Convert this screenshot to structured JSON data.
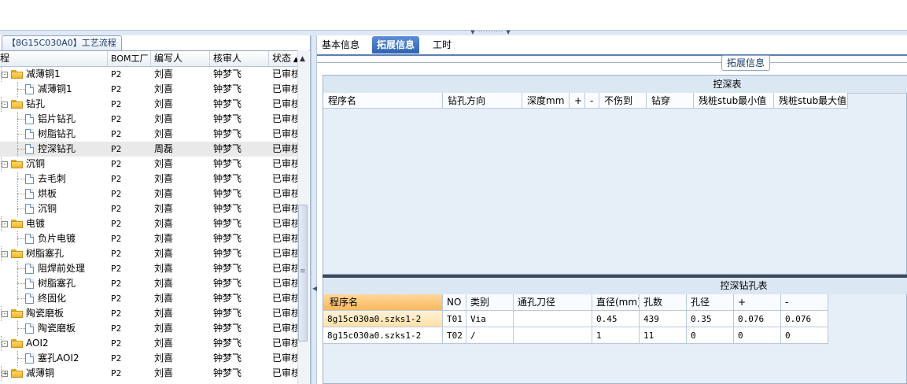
{
  "splitter_grip": "▼ ·········· ▼",
  "left_panel": {
    "title": "【8G15C030A0】工艺流程",
    "columns": [
      "程",
      "BOM工厂",
      "编写人",
      "核审人",
      "状态"
    ],
    "sort_arrow": "▲",
    "rows": [
      {
        "indent": 1,
        "type": "folder",
        "expander": "-",
        "name": "减薄铜1",
        "bom": "P2",
        "author": "刘喜",
        "reviewer": "钟梦飞",
        "status": "已审核"
      },
      {
        "indent": 2,
        "type": "file",
        "expander": "",
        "name": "减薄铜1",
        "bom": "P2",
        "author": "刘喜",
        "reviewer": "钟梦飞",
        "status": "已审核"
      },
      {
        "indent": 1,
        "type": "folder",
        "expander": "-",
        "name": "钻孔",
        "bom": "P2",
        "author": "刘喜",
        "reviewer": "钟梦飞",
        "status": "已审核"
      },
      {
        "indent": 2,
        "type": "file",
        "expander": "",
        "name": "铝片钻孔",
        "bom": "P2",
        "author": "刘喜",
        "reviewer": "钟梦飞",
        "status": "已审核"
      },
      {
        "indent": 2,
        "type": "file",
        "expander": "",
        "name": "树脂钻孔",
        "bom": "P2",
        "author": "刘喜",
        "reviewer": "钟梦飞",
        "status": "已审核"
      },
      {
        "indent": 2,
        "type": "file",
        "expander": "",
        "name": "控深钻孔",
        "bom": "P2",
        "author": "周磊",
        "reviewer": "钟梦飞",
        "status": "已审核",
        "selected": true
      },
      {
        "indent": 1,
        "type": "folder",
        "expander": "-",
        "name": "沉铜",
        "bom": "P2",
        "author": "刘喜",
        "reviewer": "钟梦飞",
        "status": "已审核"
      },
      {
        "indent": 2,
        "type": "file",
        "expander": "",
        "name": "去毛刺",
        "bom": "P2",
        "author": "刘喜",
        "reviewer": "钟梦飞",
        "status": "已审核"
      },
      {
        "indent": 2,
        "type": "file",
        "expander": "",
        "name": "烘板",
        "bom": "P2",
        "author": "刘喜",
        "reviewer": "钟梦飞",
        "status": "已审核"
      },
      {
        "indent": 2,
        "type": "file",
        "expander": "",
        "name": "沉铜",
        "bom": "P2",
        "author": "刘喜",
        "reviewer": "钟梦飞",
        "status": "已审核"
      },
      {
        "indent": 1,
        "type": "folder",
        "expander": "-",
        "name": "电镀",
        "bom": "P2",
        "author": "刘喜",
        "reviewer": "钟梦飞",
        "status": "已审核"
      },
      {
        "indent": 2,
        "type": "file",
        "expander": "",
        "name": "负片电镀",
        "bom": "P2",
        "author": "刘喜",
        "reviewer": "钟梦飞",
        "status": "已审核"
      },
      {
        "indent": 1,
        "type": "folder",
        "expander": "-",
        "name": "树脂塞孔",
        "bom": "P2",
        "author": "刘喜",
        "reviewer": "钟梦飞",
        "status": "已审核"
      },
      {
        "indent": 2,
        "type": "file",
        "expander": "",
        "name": "阻焊前处理",
        "bom": "P2",
        "author": "刘喜",
        "reviewer": "钟梦飞",
        "status": "已审核"
      },
      {
        "indent": 2,
        "type": "file",
        "expander": "",
        "name": "树脂塞孔",
        "bom": "P2",
        "author": "刘喜",
        "reviewer": "钟梦飞",
        "status": "已审核"
      },
      {
        "indent": 2,
        "type": "file",
        "expander": "",
        "name": "终固化",
        "bom": "P2",
        "author": "刘喜",
        "reviewer": "钟梦飞",
        "status": "已审核"
      },
      {
        "indent": 1,
        "type": "folder",
        "expander": "-",
        "name": "陶瓷磨板",
        "bom": "P2",
        "author": "刘喜",
        "reviewer": "钟梦飞",
        "status": "已审核"
      },
      {
        "indent": 2,
        "type": "file",
        "expander": "",
        "name": "陶瓷磨板",
        "bom": "P2",
        "author": "刘喜",
        "reviewer": "钟梦飞",
        "status": "已审核"
      },
      {
        "indent": 1,
        "type": "folder",
        "expander": "-",
        "name": "AOI2",
        "bom": "P2",
        "author": "刘喜",
        "reviewer": "钟梦飞",
        "status": "已审核"
      },
      {
        "indent": 2,
        "type": "file",
        "expander": "",
        "name": "塞孔AOI2",
        "bom": "P2",
        "author": "刘喜",
        "reviewer": "钟梦飞",
        "status": "已审核"
      },
      {
        "indent": 1,
        "type": "folder",
        "expander": "+",
        "name": "减薄铜",
        "bom": "P2",
        "author": "刘喜",
        "reviewer": "钟梦飞",
        "status": "已审核"
      }
    ]
  },
  "right_panel": {
    "tabs": [
      {
        "label": "基本信息",
        "active": false
      },
      {
        "label": "拓展信息",
        "active": true
      },
      {
        "label": "工时",
        "active": false
      }
    ],
    "group_title": "拓展信息",
    "grid1": {
      "title": "控深表",
      "columns": [
        "程序名",
        "钻孔方向",
        "深度mm",
        "+",
        "-",
        "不伤到",
        "钻穿",
        "残桩stub最小值",
        "残桩stub最大值"
      ]
    },
    "grid2": {
      "title": "控深钻孔表",
      "columns": [
        "程序名",
        "NO",
        "类别",
        "通孔刀径",
        "直径(mm)",
        "孔数",
        "孔径",
        "+",
        "-"
      ],
      "rows": [
        [
          "8g15c030a0.szks1-2",
          "T01",
          "Via",
          "",
          "0.45",
          "439",
          "0.35",
          "0.076",
          "0.076"
        ],
        [
          "8g15c030a0.szks1-2",
          "T02",
          "/",
          "",
          "1",
          "11",
          "0",
          "0",
          "0"
        ]
      ]
    }
  },
  "colors": {
    "accent_tab": "#2f63ad",
    "grid_bg": "#e6eef8",
    "sorted_header": "#f7b95d",
    "folder": "#f0b52a"
  }
}
